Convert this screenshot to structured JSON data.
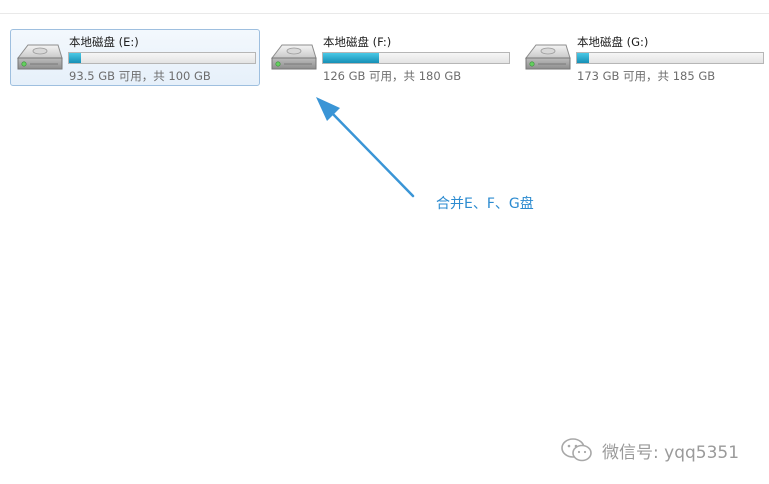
{
  "drives": [
    {
      "name": "本地磁盘 (E:)",
      "info": "93.5 GB 可用，共 100 GB",
      "used_fraction": 0.065,
      "selected": true
    },
    {
      "name": "本地磁盘 (F:)",
      "info": "126 GB 可用，共 180 GB",
      "used_fraction": 0.3,
      "selected": false
    },
    {
      "name": "本地磁盘 (G:)",
      "info": "173 GB 可用，共 185 GB",
      "used_fraction": 0.065,
      "selected": false
    }
  ],
  "annotation": {
    "text": "合并E、F、G盘",
    "color": "#2c8bd0"
  },
  "watermark": {
    "text": "微信号: yqq5351"
  },
  "colors": {
    "bar_fill": "#1a9bc4",
    "selection_border": "#9ebfdf"
  }
}
